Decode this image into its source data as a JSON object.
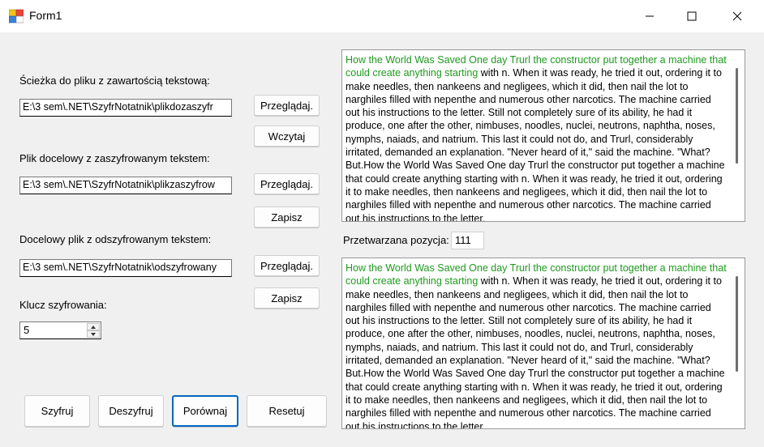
{
  "window": {
    "title": "Form1"
  },
  "labels": {
    "source_path": "Ścieżka do pliku z zawartością tekstową:",
    "encrypted_path": "Plik docelowy z zaszyfrowanym tekstem:",
    "decrypted_path": "Docelowy plik z odszyfrowanym tekstem:",
    "key": "Klucz szyfrowania:",
    "position": "Przetwarzana pozycja:"
  },
  "inputs": {
    "source_path": "E:\\3 sem\\.NET\\SzyfrNotatnik\\plikdozaszyfr",
    "encrypted_path": "E:\\3 sem\\.NET\\SzyfrNotatnik\\plikzaszyfrow",
    "decrypted_path": "E:\\3 sem\\.NET\\SzyfrNotatnik\\odszyfrowany",
    "key": "5",
    "position": "111"
  },
  "buttons": {
    "browse": "Przeglądaj.",
    "load": "Wczytaj",
    "save": "Zapisz",
    "encrypt": "Szyfruj",
    "decrypt": "Deszyfruj",
    "compare": "Porównaj",
    "reset": "Resetuj"
  },
  "text_top": {
    "highlighted": "How the World Was Saved One day Trurl the constructor put together a machine that could create anything starting",
    "rest": " with n. When it was ready, he tried it out, ordering it to make needles, then nankeens and negligees, which it did, then nail the lot to narghiles filled with nepenthe and numerous other narcotics. The machine carried out his instructions to the letter. Still not completely sure of its ability, he had it produce, one after the other, nimbuses, noodles, nuclei, neutrons, naphtha, noses, nymphs, naiads, and natrium. This last it could not do, and Trurl, considerably irritated, demanded an explanation. \"Never heard of it,\" said the machine. \"What? But.How the World Was Saved One day Trurl the constructor put together a machine that could create anything starting with n. When it was ready, he tried it out, ordering it to make needles, then nankeens and negligees, which it did, then nail the lot to narghiles filled with nepenthe and numerous other narcotics. The machine carried out his instructions to the letter."
  },
  "text_bottom": {
    "highlighted": "How the World Was Saved One day Trurl the constructor put together a machine that could create anything starting",
    "rest": " with n. When it was ready, he tried it out, ordering it to make needles, then nankeens and negligees, which it did, then nail the lot to narghiles filled with nepenthe and numerous other narcotics. The machine carried out his instructions to the letter. Still not completely sure of its ability, he had it produce, one after the other, nimbuses, noodles, nuclei, neutrons, naphtha, noses, nymphs, naiads, and natrium. This last it could not do, and Trurl, considerably irritated, demanded an explanation. \"Never heard of it,\" said the machine. \"What? But.How the World Was Saved One day Trurl the constructor put together a machine that could create anything starting with n. When it was ready, he tried it out, ordering it to make needles, then nankeens and negligees, which it did, then nail the lot to narghiles filled with nepenthe and numerous other narcotics. The machine carried out his instructions to the letter."
  },
  "colors": {
    "highlight": "#1e9a1e",
    "focus": "#0067c0"
  }
}
